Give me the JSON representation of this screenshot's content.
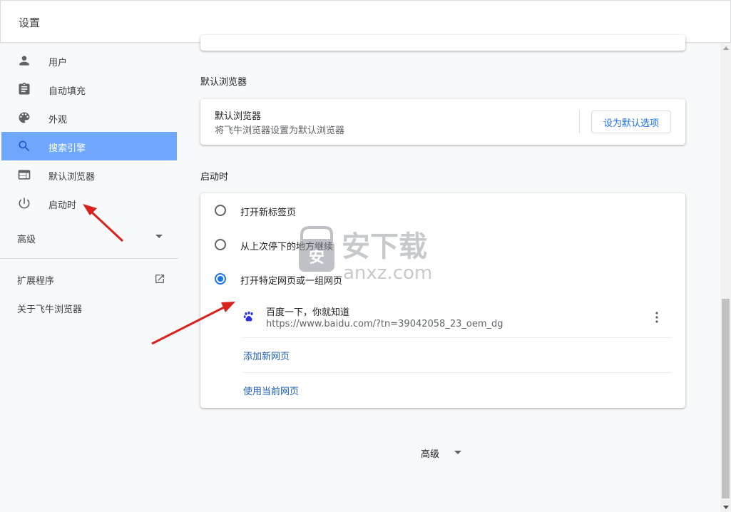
{
  "topbar": {
    "title": "设置"
  },
  "sidebar": {
    "items": [
      {
        "label": "用户",
        "icon": "person-icon",
        "active": false
      },
      {
        "label": "自动填充",
        "icon": "clipboard-icon",
        "active": false
      },
      {
        "label": "外观",
        "icon": "palette-icon",
        "active": false
      },
      {
        "label": "搜索引擎",
        "icon": "search-icon",
        "active": true
      },
      {
        "label": "默认浏览器",
        "icon": "browser-window-icon",
        "active": false
      },
      {
        "label": "启动时",
        "icon": "power-icon",
        "active": false
      }
    ],
    "advanced_label": "高级",
    "extensions_label": "扩展程序",
    "about_label": "关于飞牛浏览器"
  },
  "default_browser": {
    "section_title": "默认浏览器",
    "row_title": "默认浏览器",
    "row_subtitle": "将飞牛浏览器设置为默认浏览器",
    "button_label": "设为默认选项"
  },
  "on_startup": {
    "section_title": "启动时",
    "options": [
      {
        "label": "打开新标签页",
        "checked": false
      },
      {
        "label": "从上次停下的地方继续",
        "checked": false
      },
      {
        "label": "打开特定网页或一组网页",
        "checked": true
      }
    ],
    "page": {
      "title": "百度一下，你就知道",
      "url": "https://www.baidu.com/?tn=39042058_23_oem_dg",
      "icon": "baidu-paw-icon"
    },
    "add_page_label": "添加新网页",
    "use_current_label": "使用当前网页"
  },
  "footer": {
    "advanced_label": "高级"
  },
  "watermark": {
    "big_text": "安下载",
    "small_text": "anxz.com",
    "badge_text": "安"
  },
  "colors": {
    "accent": "#1a73e8",
    "active_nav": "#6ea7fb",
    "arrow": "#d9221c"
  }
}
